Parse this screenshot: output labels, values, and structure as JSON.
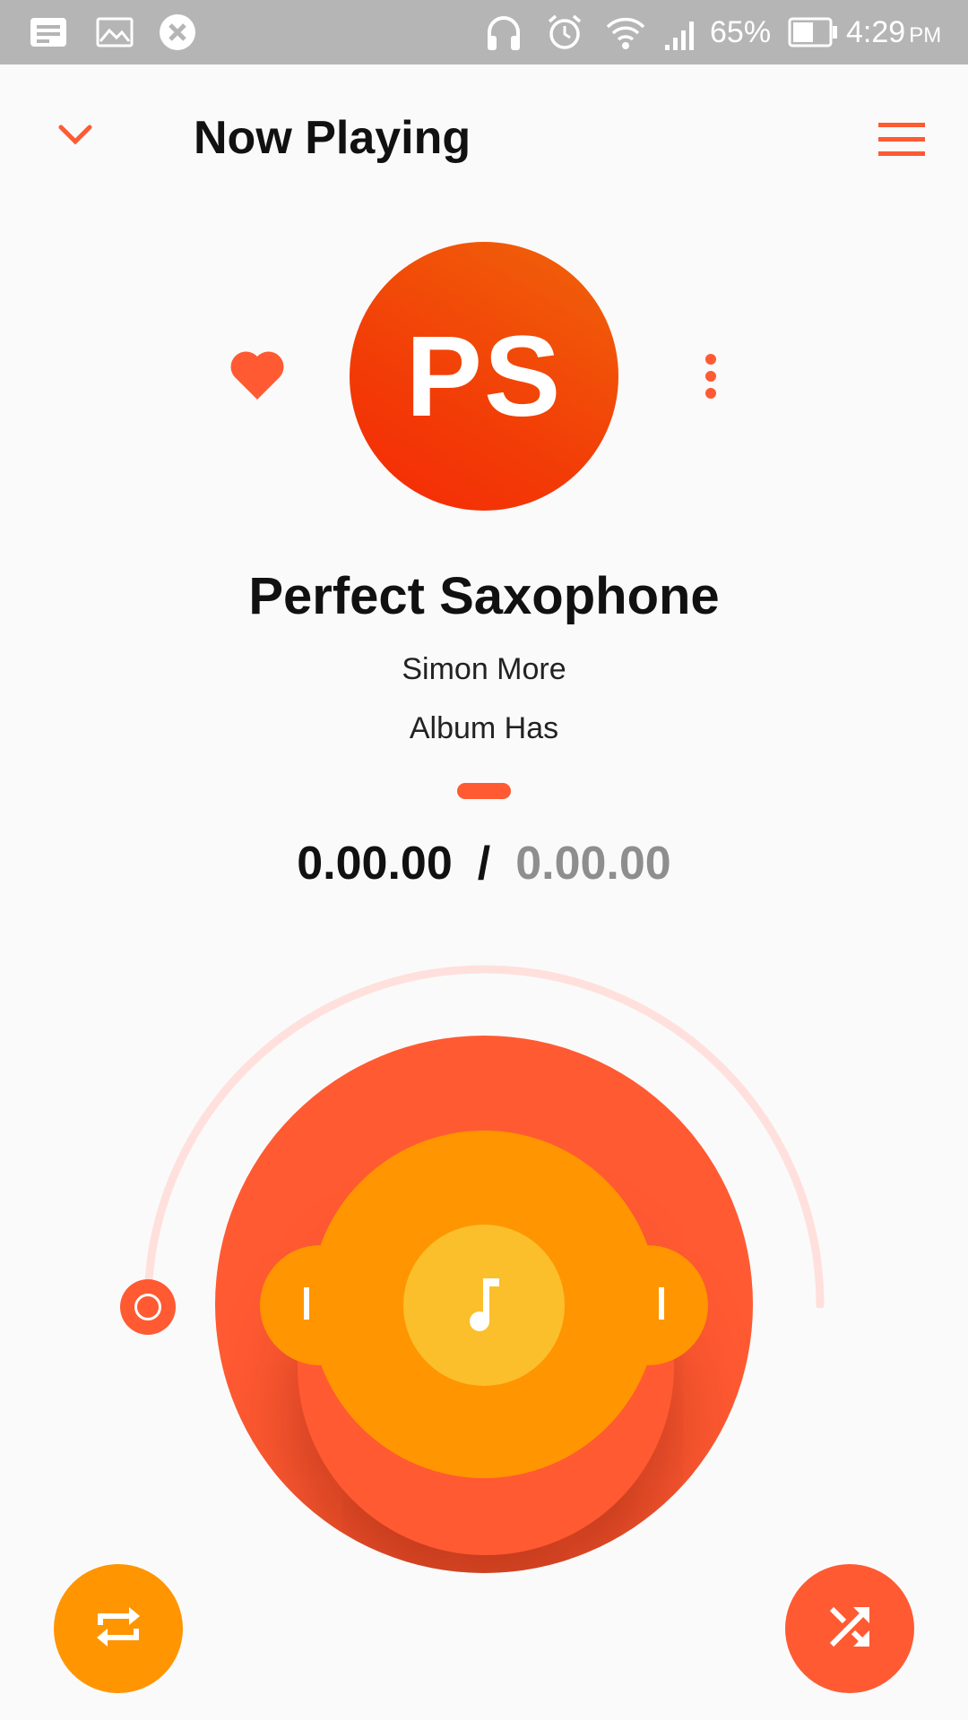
{
  "status_bar": {
    "icons": [
      "message-icon",
      "image-icon",
      "blocked-icon",
      "headphones-icon",
      "alarm-icon",
      "wifi-icon",
      "signal-icon",
      "battery-icon"
    ],
    "battery": "65%",
    "time": "4:29",
    "ampm": "PM"
  },
  "header": {
    "title": "Now Playing",
    "back_icon": "chevron-down-icon",
    "menu_icon": "hamburger-menu-icon"
  },
  "track": {
    "initials": "PS",
    "title": "Perfect Saxophone",
    "artist": "Simon More",
    "album": "Album Has",
    "current_time": "0.00.00",
    "separator": "/",
    "total_time": "0.00.00",
    "favorite_icon": "heart-icon",
    "more_icon": "more-vertical-icon"
  },
  "controls": {
    "previous_icon": "skip-previous-icon",
    "play_icon": "music-note-icon",
    "next_icon": "skip-next-icon",
    "repeat_icon": "repeat-icon",
    "shuffle_icon": "shuffle-icon",
    "progress": 0
  },
  "colors": {
    "accent": "#ff5a32",
    "orange": "#ff9500",
    "yellow": "#fbbf2c",
    "avatar_red": "#f23d07",
    "arc_track": "#ffe0dc",
    "status_bar": "#b5b5b5"
  }
}
